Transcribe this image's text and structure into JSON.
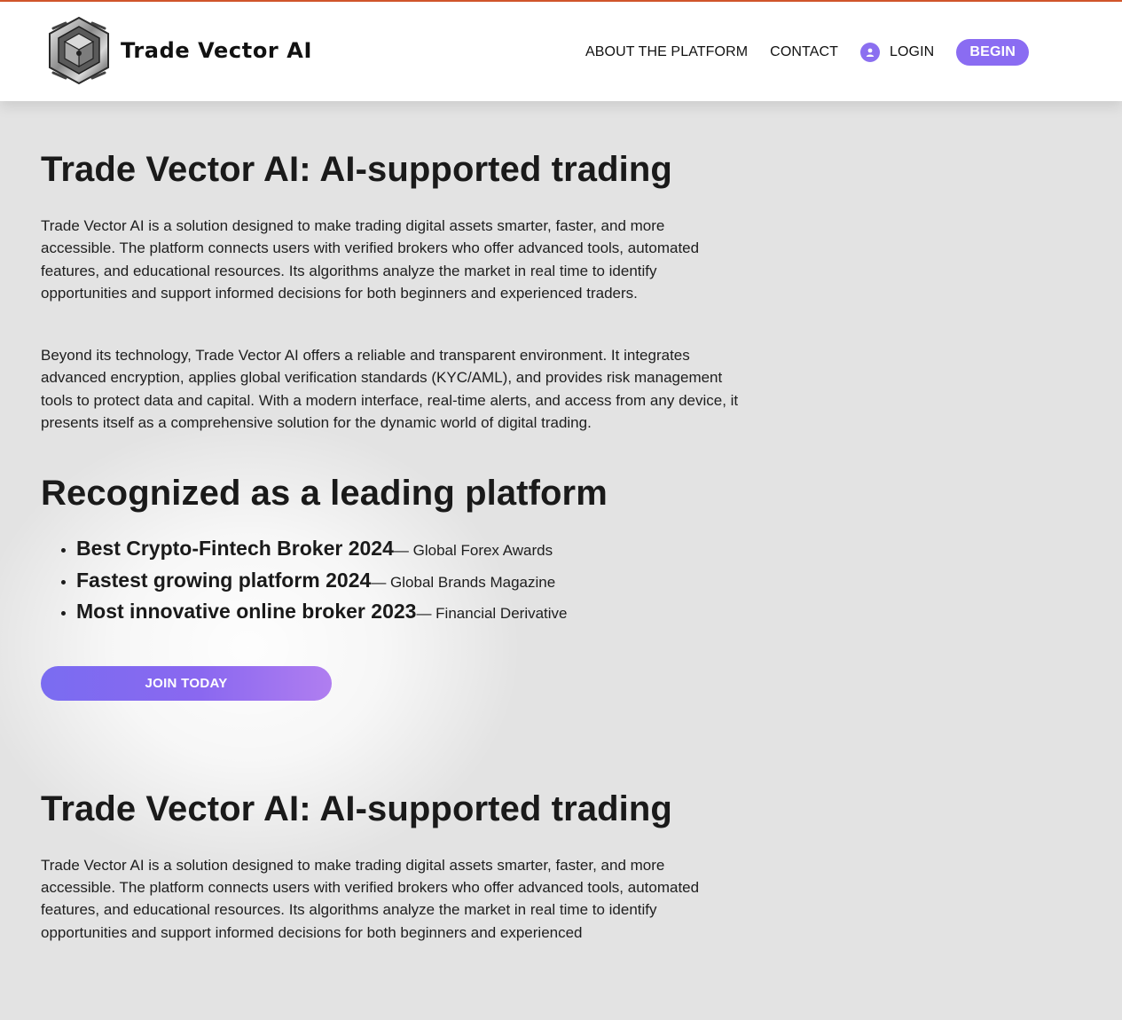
{
  "header": {
    "brand": "Trade Vector AI",
    "nav": {
      "about": "ABOUT THE PLATFORM",
      "contact": "CONTACT",
      "login": "LOGIN",
      "begin": "BEGIN"
    }
  },
  "section1": {
    "title": "Trade Vector AI: AI-supported trading",
    "paragraph1": "Trade Vector AI is a solution designed to make trading digital assets smarter, faster, and more accessible. The platform connects users with verified brokers who offer advanced tools, automated features, and educational resources. Its algorithms analyze the market in real time to identify opportunities and support informed decisions for both beginners and experienced traders.",
    "paragraph2": "Beyond its technology, Trade Vector AI offers a reliable and transparent environment. It integrates advanced encryption, applies global verification standards (KYC/AML), and provides risk management tools to protect data and capital. With a modern interface, real-time alerts, and access from any device, it presents itself as a comprehensive solution for the dynamic world of digital trading."
  },
  "section2": {
    "title": "Recognized as a leading platform",
    "awards": [
      {
        "title": "Best Crypto-Fintech Broker 2024",
        "source": "— Global Forex Awards"
      },
      {
        "title": "Fastest growing platform 2024",
        "source": "— Global Brands Magazine"
      },
      {
        "title": "Most innovative online broker 2023",
        "source": "— Financial Derivative"
      }
    ],
    "cta": "JOIN TODAY"
  },
  "section3": {
    "title": "Trade Vector AI: AI-supported trading",
    "paragraph1": "Trade Vector AI is a solution designed to make trading digital assets smarter, faster, and more accessible. The platform connects users with verified brokers who offer advanced tools, automated features, and educational resources. Its algorithms analyze the market in real time to identify opportunities and support informed decisions for both beginners and experienced"
  },
  "icons": {
    "logo": "metallic-cube-logo-icon",
    "login": "user-icon"
  },
  "colors": {
    "accent": "#8a6cf2",
    "top_border": "#d4572c",
    "page_background": "#e3e3e3"
  }
}
